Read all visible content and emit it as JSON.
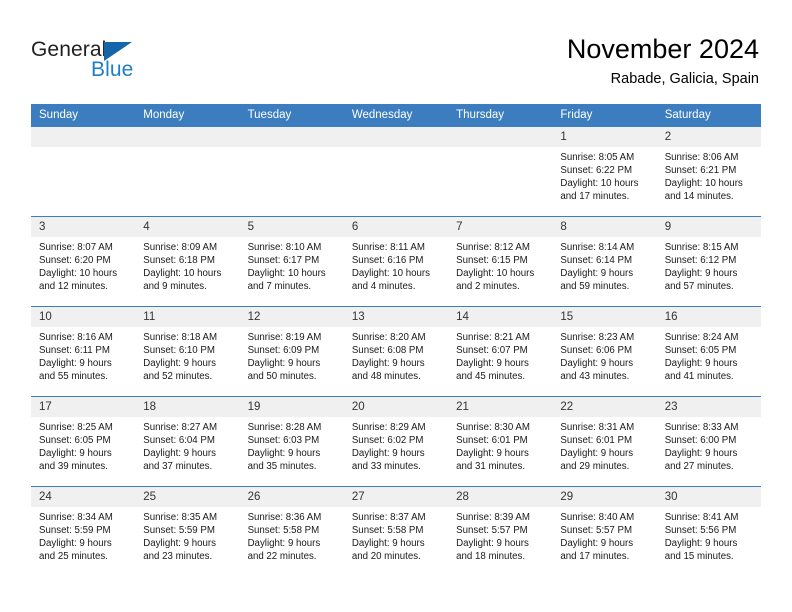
{
  "logo": {
    "text_primary": "General",
    "text_secondary": "Blue",
    "icon": "triangle-logo-mark",
    "color_primary": "#231f20",
    "color_secondary": "#1f7fc4",
    "color_mark": "#1565a8"
  },
  "header": {
    "title": "November 2024",
    "subtitle": "Rabade, Galicia, Spain"
  },
  "theme": {
    "header_bg": "#3b7dbf",
    "header_text": "#ffffff",
    "daynum_bg": "#f0f0f0",
    "cell_border": "#3b7dbf"
  },
  "weekdays": [
    "Sunday",
    "Monday",
    "Tuesday",
    "Wednesday",
    "Thursday",
    "Friday",
    "Saturday"
  ],
  "weeks": [
    [
      {
        "day": "",
        "empty": true
      },
      {
        "day": "",
        "empty": true
      },
      {
        "day": "",
        "empty": true
      },
      {
        "day": "",
        "empty": true
      },
      {
        "day": "",
        "empty": true
      },
      {
        "day": "1",
        "sunrise": "Sunrise: 8:05 AM",
        "sunset": "Sunset: 6:22 PM",
        "daylight": "Daylight: 10 hours and 17 minutes."
      },
      {
        "day": "2",
        "sunrise": "Sunrise: 8:06 AM",
        "sunset": "Sunset: 6:21 PM",
        "daylight": "Daylight: 10 hours and 14 minutes."
      }
    ],
    [
      {
        "day": "3",
        "sunrise": "Sunrise: 8:07 AM",
        "sunset": "Sunset: 6:20 PM",
        "daylight": "Daylight: 10 hours and 12 minutes."
      },
      {
        "day": "4",
        "sunrise": "Sunrise: 8:09 AM",
        "sunset": "Sunset: 6:18 PM",
        "daylight": "Daylight: 10 hours and 9 minutes."
      },
      {
        "day": "5",
        "sunrise": "Sunrise: 8:10 AM",
        "sunset": "Sunset: 6:17 PM",
        "daylight": "Daylight: 10 hours and 7 minutes."
      },
      {
        "day": "6",
        "sunrise": "Sunrise: 8:11 AM",
        "sunset": "Sunset: 6:16 PM",
        "daylight": "Daylight: 10 hours and 4 minutes."
      },
      {
        "day": "7",
        "sunrise": "Sunrise: 8:12 AM",
        "sunset": "Sunset: 6:15 PM",
        "daylight": "Daylight: 10 hours and 2 minutes."
      },
      {
        "day": "8",
        "sunrise": "Sunrise: 8:14 AM",
        "sunset": "Sunset: 6:14 PM",
        "daylight": "Daylight: 9 hours and 59 minutes."
      },
      {
        "day": "9",
        "sunrise": "Sunrise: 8:15 AM",
        "sunset": "Sunset: 6:12 PM",
        "daylight": "Daylight: 9 hours and 57 minutes."
      }
    ],
    [
      {
        "day": "10",
        "sunrise": "Sunrise: 8:16 AM",
        "sunset": "Sunset: 6:11 PM",
        "daylight": "Daylight: 9 hours and 55 minutes."
      },
      {
        "day": "11",
        "sunrise": "Sunrise: 8:18 AM",
        "sunset": "Sunset: 6:10 PM",
        "daylight": "Daylight: 9 hours and 52 minutes."
      },
      {
        "day": "12",
        "sunrise": "Sunrise: 8:19 AM",
        "sunset": "Sunset: 6:09 PM",
        "daylight": "Daylight: 9 hours and 50 minutes."
      },
      {
        "day": "13",
        "sunrise": "Sunrise: 8:20 AM",
        "sunset": "Sunset: 6:08 PM",
        "daylight": "Daylight: 9 hours and 48 minutes."
      },
      {
        "day": "14",
        "sunrise": "Sunrise: 8:21 AM",
        "sunset": "Sunset: 6:07 PM",
        "daylight": "Daylight: 9 hours and 45 minutes."
      },
      {
        "day": "15",
        "sunrise": "Sunrise: 8:23 AM",
        "sunset": "Sunset: 6:06 PM",
        "daylight": "Daylight: 9 hours and 43 minutes."
      },
      {
        "day": "16",
        "sunrise": "Sunrise: 8:24 AM",
        "sunset": "Sunset: 6:05 PM",
        "daylight": "Daylight: 9 hours and 41 minutes."
      }
    ],
    [
      {
        "day": "17",
        "sunrise": "Sunrise: 8:25 AM",
        "sunset": "Sunset: 6:05 PM",
        "daylight": "Daylight: 9 hours and 39 minutes."
      },
      {
        "day": "18",
        "sunrise": "Sunrise: 8:27 AM",
        "sunset": "Sunset: 6:04 PM",
        "daylight": "Daylight: 9 hours and 37 minutes."
      },
      {
        "day": "19",
        "sunrise": "Sunrise: 8:28 AM",
        "sunset": "Sunset: 6:03 PM",
        "daylight": "Daylight: 9 hours and 35 minutes."
      },
      {
        "day": "20",
        "sunrise": "Sunrise: 8:29 AM",
        "sunset": "Sunset: 6:02 PM",
        "daylight": "Daylight: 9 hours and 33 minutes."
      },
      {
        "day": "21",
        "sunrise": "Sunrise: 8:30 AM",
        "sunset": "Sunset: 6:01 PM",
        "daylight": "Daylight: 9 hours and 31 minutes."
      },
      {
        "day": "22",
        "sunrise": "Sunrise: 8:31 AM",
        "sunset": "Sunset: 6:01 PM",
        "daylight": "Daylight: 9 hours and 29 minutes."
      },
      {
        "day": "23",
        "sunrise": "Sunrise: 8:33 AM",
        "sunset": "Sunset: 6:00 PM",
        "daylight": "Daylight: 9 hours and 27 minutes."
      }
    ],
    [
      {
        "day": "24",
        "sunrise": "Sunrise: 8:34 AM",
        "sunset": "Sunset: 5:59 PM",
        "daylight": "Daylight: 9 hours and 25 minutes."
      },
      {
        "day": "25",
        "sunrise": "Sunrise: 8:35 AM",
        "sunset": "Sunset: 5:59 PM",
        "daylight": "Daylight: 9 hours and 23 minutes."
      },
      {
        "day": "26",
        "sunrise": "Sunrise: 8:36 AM",
        "sunset": "Sunset: 5:58 PM",
        "daylight": "Daylight: 9 hours and 22 minutes."
      },
      {
        "day": "27",
        "sunrise": "Sunrise: 8:37 AM",
        "sunset": "Sunset: 5:58 PM",
        "daylight": "Daylight: 9 hours and 20 minutes."
      },
      {
        "day": "28",
        "sunrise": "Sunrise: 8:39 AM",
        "sunset": "Sunset: 5:57 PM",
        "daylight": "Daylight: 9 hours and 18 minutes."
      },
      {
        "day": "29",
        "sunrise": "Sunrise: 8:40 AM",
        "sunset": "Sunset: 5:57 PM",
        "daylight": "Daylight: 9 hours and 17 minutes."
      },
      {
        "day": "30",
        "sunrise": "Sunrise: 8:41 AM",
        "sunset": "Sunset: 5:56 PM",
        "daylight": "Daylight: 9 hours and 15 minutes."
      }
    ]
  ]
}
